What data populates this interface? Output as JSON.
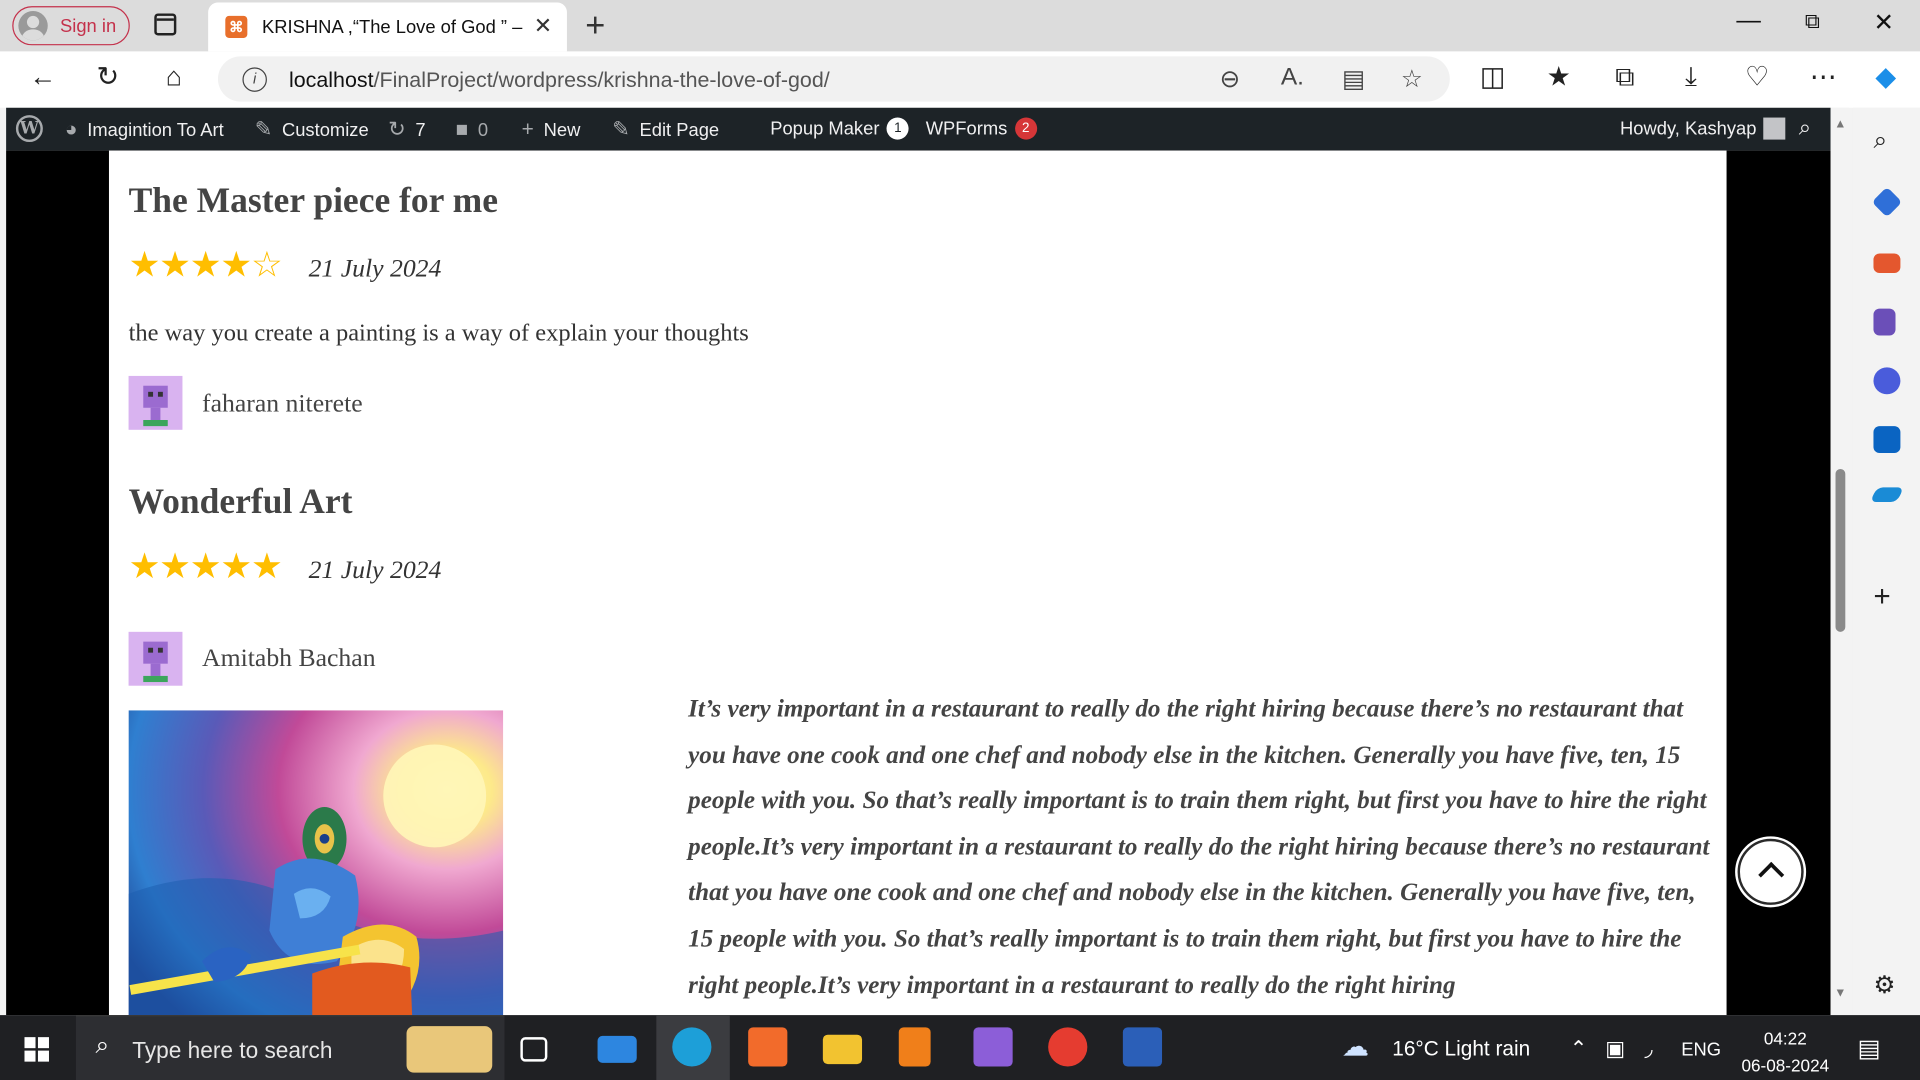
{
  "browser": {
    "signin_label": "Sign in",
    "tab_title": "KRISHNA ,“The Love of God ” – Im",
    "url_host": "localhost",
    "url_path": "/FinalProject/wordpress/krishna-the-love-of-god/"
  },
  "wpbar": {
    "site_name": "Imagintion To Art",
    "customize": "Customize",
    "updates_count": "7",
    "comments_count": "0",
    "new_label": "New",
    "edit_page": "Edit Page",
    "popup_maker": "Popup Maker",
    "popup_badge": "1",
    "wpforms": "WPForms",
    "wpforms_badge": "2",
    "howdy": "Howdy, Kashyap"
  },
  "reviews": [
    {
      "title": "The Master piece for me",
      "rating": 4,
      "max_rating": 5,
      "date": "21 July 2024",
      "body": "the way you create a painting is a way of explain your thoughts",
      "author": "faharan niterete"
    },
    {
      "title": "Wonderful Art",
      "rating": 5,
      "max_rating": 5,
      "date": "21 July 2024",
      "body": "",
      "author": "Amitabh Bachan"
    }
  ],
  "quote_text": "It’s very important in a restaurant to really do the right hiring because there’s no restaurant that you have one cook and one chef and nobody else in the kitchen. Generally you have five, ten, 15 people with you. So that’s really important is to train them right, but first you have to hire the right people.It’s very important in a restaurant to really do the right hiring because there’s no restaurant that you have one cook and one chef and nobody else in the kitchen. Generally you have five, ten, 15 people with you. So that’s really important is to train them right, but first you have to hire the right people.It’s very important in a restaurant to really do the right hiring",
  "taskbar": {
    "search_placeholder": "Type here to search",
    "weather": "16°C  Light rain",
    "lang": "ENG",
    "time": "04:22",
    "date": "06-08-2024"
  },
  "colors": {
    "star": "#ffbe00",
    "wp_bar": "#1d2327",
    "badge_red": "#d63638"
  }
}
